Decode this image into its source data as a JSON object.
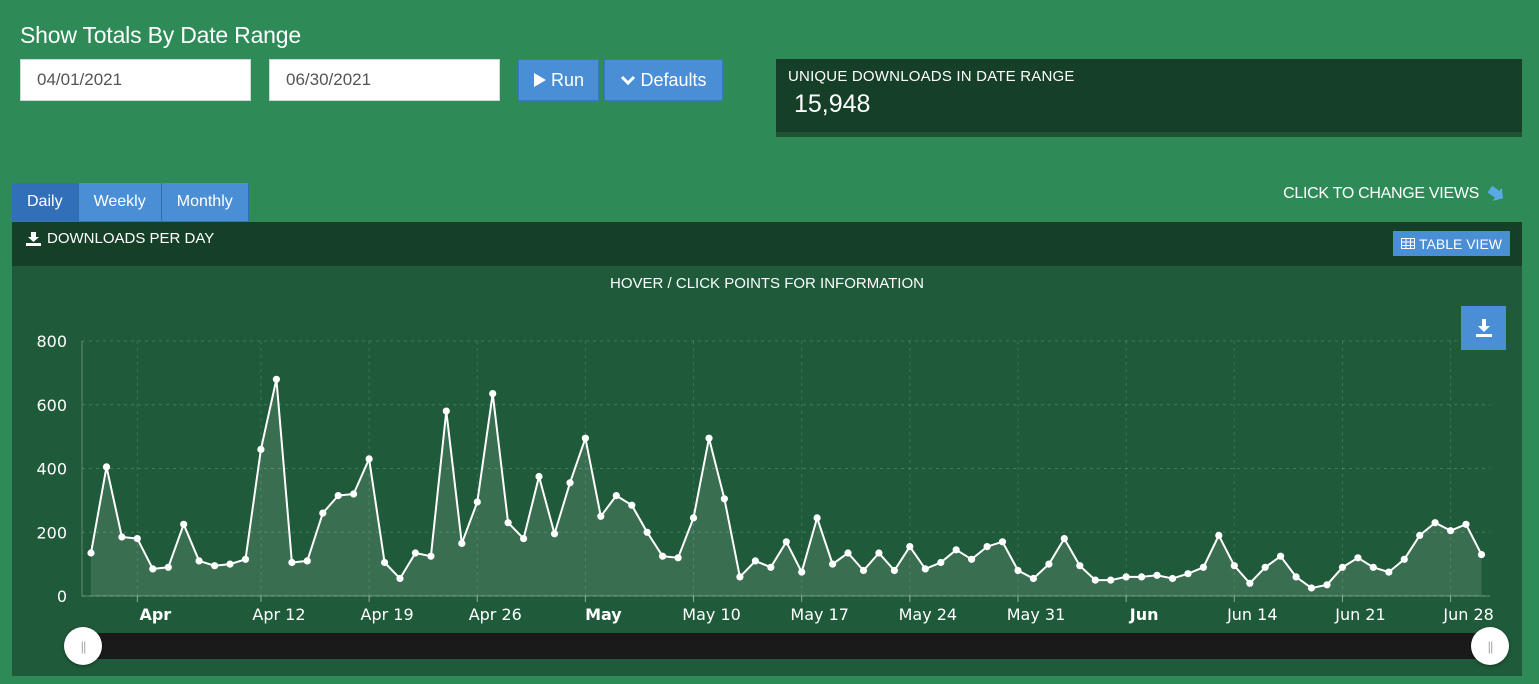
{
  "header": {
    "title": "Show Totals By Date Range"
  },
  "filters": {
    "start_date": "04/01/2021",
    "end_date": "06/30/2021",
    "run_label": "Run",
    "defaults_label": "Defaults"
  },
  "stat": {
    "label": "UNIQUE DOWNLOADS IN DATE RANGE",
    "value": "15,948"
  },
  "tabs": [
    {
      "label": "Daily",
      "active": true
    },
    {
      "label": "Weekly",
      "active": false
    },
    {
      "label": "Monthly",
      "active": false
    }
  ],
  "change_views_label": "CLICK TO CHANGE VIEWS",
  "panel": {
    "title": "DOWNLOADS PER DAY",
    "table_view_label": "TABLE VIEW",
    "hint": "HOVER / CLICK POINTS FOR INFORMATION"
  },
  "colors": {
    "background": "#2e8b57",
    "panel": "#1f5a3a",
    "header": "#163f28",
    "accent": "#4a8fd6",
    "line": "#ffffff"
  },
  "chart_data": {
    "type": "area",
    "x_start": "2021-04-01",
    "x_end": "2021-06-30",
    "ylim": [
      0,
      800
    ],
    "yticks": [
      0,
      200,
      400,
      600,
      800
    ],
    "xticks": [
      {
        "label": "Apr",
        "date": "2021-04-04",
        "bold": true
      },
      {
        "label": "Apr 12",
        "date": "2021-04-12",
        "bold": false
      },
      {
        "label": "Apr 19",
        "date": "2021-04-19",
        "bold": false
      },
      {
        "label": "Apr 26",
        "date": "2021-04-26",
        "bold": false
      },
      {
        "label": "May",
        "date": "2021-05-03",
        "bold": true
      },
      {
        "label": "May 10",
        "date": "2021-05-10",
        "bold": false
      },
      {
        "label": "May 17",
        "date": "2021-05-17",
        "bold": false
      },
      {
        "label": "May 24",
        "date": "2021-05-24",
        "bold": false
      },
      {
        "label": "May 31",
        "date": "2021-05-31",
        "bold": false
      },
      {
        "label": "Jun",
        "date": "2021-06-07",
        "bold": true
      },
      {
        "label": "Jun 14",
        "date": "2021-06-14",
        "bold": false
      },
      {
        "label": "Jun 21",
        "date": "2021-06-21",
        "bold": false
      },
      {
        "label": "Jun 28",
        "date": "2021-06-28",
        "bold": false
      }
    ],
    "grid": true,
    "series": [
      {
        "values": [
          135,
          405,
          185,
          180,
          85,
          90,
          225,
          110,
          95,
          100,
          115,
          460,
          680,
          105,
          110,
          260,
          315,
          320,
          430,
          105,
          55,
          135,
          125,
          580,
          165,
          295,
          635,
          230,
          180,
          375,
          195,
          355,
          495,
          250,
          315,
          285,
          200,
          125,
          120,
          245,
          495,
          305,
          60,
          110,
          90,
          170,
          75,
          245,
          100,
          135,
          80,
          135,
          80,
          155,
          85,
          105,
          145,
          115,
          155,
          170,
          80,
          55,
          100,
          180,
          95,
          50,
          50,
          60,
          60,
          65,
          55,
          70,
          90,
          190,
          95,
          40,
          90,
          125,
          60,
          25,
          35,
          90,
          120,
          90,
          75,
          115,
          190,
          230,
          205,
          225,
          130
        ]
      }
    ]
  }
}
